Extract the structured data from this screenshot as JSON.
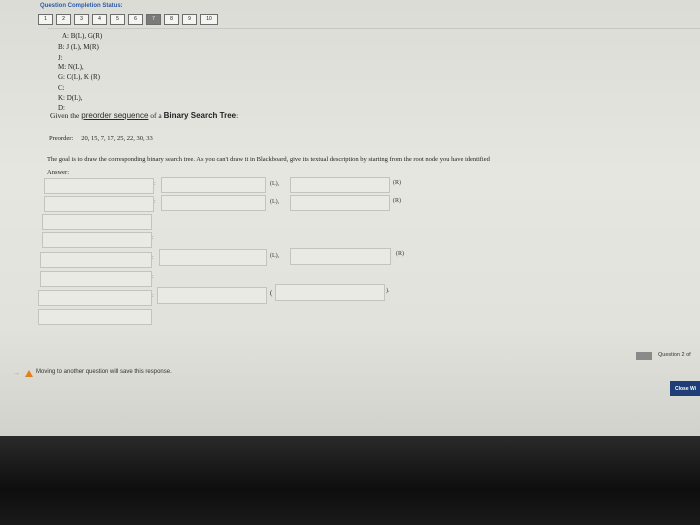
{
  "header": {
    "status_title": "Question Completion Status:",
    "question_numbers": [
      "1",
      "2",
      "3",
      "4",
      "5",
      "6",
      "7",
      "8",
      "9",
      "10"
    ]
  },
  "tree_lines": [
    "A: B(L), G(R)",
    "B: J (L), M(R)",
    "J:",
    "M: N(L),",
    "G: C(L), K (R)",
    "C:",
    "K: D(L),",
    "D:"
  ],
  "question": {
    "intro_prefix": "Given the",
    "intro_link": "preorder sequence",
    "intro_mid": "of a",
    "intro_bold": "Binary Search Tree",
    "intro_suffix": ":",
    "preorder_label": "Preorder:",
    "preorder_values": "20, 15, 7, 17, 25, 22, 30, 33",
    "goal_text": "The goal is to draw the corresponding binary search tree.  As you can't draw it in Blackboard, give its textual description by starting from the root node you have identified",
    "answer_label": "Answer:"
  },
  "answer_grid": {
    "colon": ":",
    "left_label": "(L),",
    "right_label": "(R)",
    "open_paren": "(",
    "close_paren": ")."
  },
  "footer": {
    "question_count": "Question 2 of",
    "warning": "Moving to another question will save this response.",
    "close_button": "Close Wi"
  }
}
